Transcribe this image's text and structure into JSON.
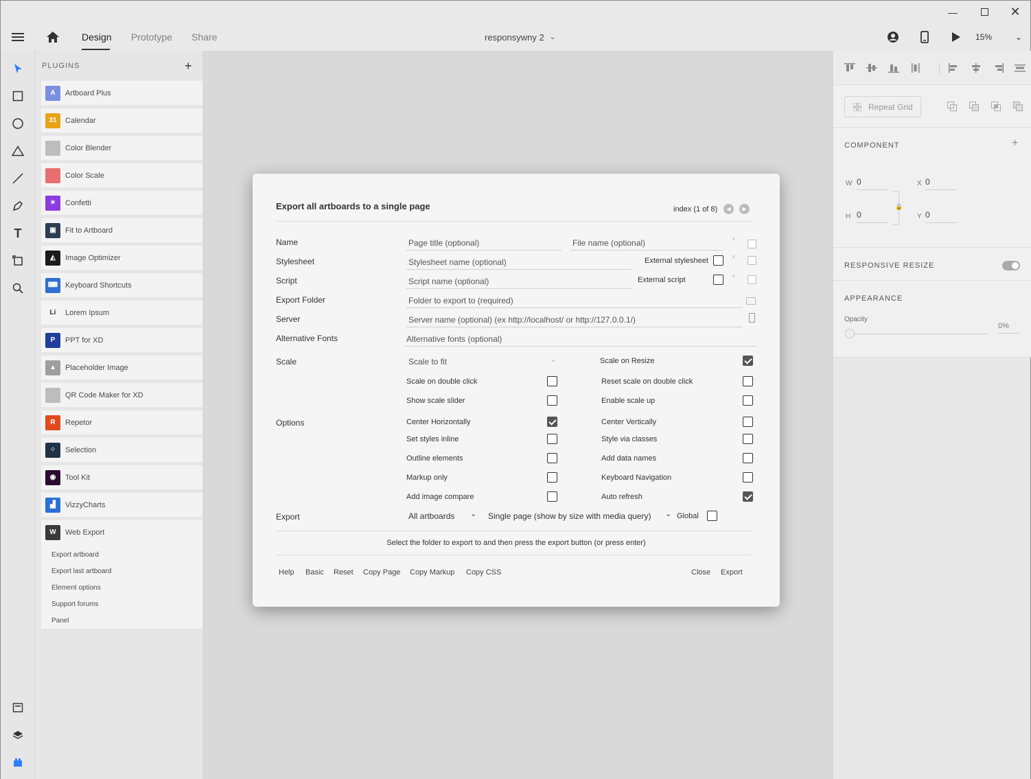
{
  "toolbar": {
    "tab_design": "Design",
    "tab_prototype": "Prototype",
    "tab_share": "Share",
    "doc_title": "responsywny 2",
    "zoom": "15%"
  },
  "plugins": {
    "heading": "PLUGINS",
    "items": [
      {
        "label": "Artboard Plus",
        "icon": "A",
        "color": "#7b8fe0"
      },
      {
        "label": "Calendar",
        "icon": "31",
        "color": "#e8a317"
      },
      {
        "label": "Color Blender",
        "icon": "",
        "color": "#bdbdbd"
      },
      {
        "label": "Color Scale",
        "icon": "",
        "color": "#e96f6f"
      },
      {
        "label": "Confetti",
        "icon": "✶",
        "color": "#8a3ce0"
      },
      {
        "label": "Fit to Artboard",
        "icon": "▣",
        "color": "#2c3e50"
      },
      {
        "label": "Image Optimizer",
        "icon": "◭",
        "color": "#1c1c1c"
      },
      {
        "label": "Keyboard Shortcuts",
        "icon": "⌨",
        "color": "#2f6fd1"
      },
      {
        "label": "Lorem Ipsum",
        "icon": "Li",
        "color": "#f4f4f4"
      },
      {
        "label": "PPT for XD",
        "icon": "P",
        "color": "#1f3f9a"
      },
      {
        "label": "Placeholder Image",
        "icon": "▲",
        "color": "#9e9e9e"
      },
      {
        "label": "QR Code Maker for XD",
        "icon": "",
        "color": "#bdbdbd"
      },
      {
        "label": "Repetor",
        "icon": "R",
        "color": "#e24a1e"
      },
      {
        "label": "Selection",
        "icon": "⁘",
        "color": "#1f3347"
      },
      {
        "label": "Tool Kit",
        "icon": "◉",
        "color": "#2a0a2e"
      },
      {
        "label": "VizzyCharts",
        "icon": "▟",
        "color": "#2a6fd6"
      },
      {
        "label": "Web Export",
        "icon": "W",
        "color": "#3a3a3a"
      }
    ],
    "sub_items": [
      "Export artboard",
      "Export last artboard",
      "Element options",
      "Support forums",
      "Panel"
    ]
  },
  "right": {
    "repeat_grid": "Repeat Grid",
    "component": "COMPONENT",
    "w_label": "W",
    "w_val": "0",
    "x_label": "X",
    "x_val": "0",
    "h_label": "H",
    "h_val": "0",
    "y_label": "Y",
    "y_val": "0",
    "responsive": "RESPONSIVE RESIZE",
    "appearance": "APPEARANCE",
    "opacity": "Opacity",
    "opacity_val": "0%"
  },
  "dialog": {
    "title": "Export all artboards to a single page",
    "index": "index (1 of 8)",
    "name_lbl": "Name",
    "name_ph": "Page title (optional)",
    "file_ph": "File name (optional)",
    "style_lbl": "Stylesheet",
    "style_ph": "Stylesheet name (optional)",
    "ext_style": "External stylesheet",
    "script_lbl": "Script",
    "script_ph": "Script name (optional)",
    "ext_script": "External script",
    "folder_lbl": "Export Folder",
    "folder_ph": "Folder to export to (required)",
    "server_lbl": "Server",
    "server_ph": "Server name (optional) (ex http://localhost/ or http://127.0.0.1/)",
    "alt_lbl": "Alternative Fonts",
    "alt_ph": "Alternative fonts (optional)",
    "scale_lbl": "Scale",
    "scale_val": "Scale to fit",
    "scale_resize": "Scale on Resize",
    "scale_dbl": "Scale on double click",
    "reset_dbl": "Reset scale on double click",
    "scale_slider": "Show scale slider",
    "enable_up": "Enable scale up",
    "options_lbl": "Options",
    "center_h": "Center Horizontally",
    "center_v": "Center Vertically",
    "styles_inline": "Set styles inline",
    "style_classes": "Style via classes",
    "outline": "Outline elements",
    "data_names": "Add data names",
    "markup_only": "Markup only",
    "kbd_nav": "Keyboard Navigation",
    "img_compare": "Add image compare",
    "auto_refresh": "Auto refresh",
    "export_lbl": "Export",
    "export_sel": "All artboards",
    "page_sel": "Single page (show by size with media query)",
    "global": "Global",
    "status": "Select the folder to export to and then press the export button (or press enter)",
    "btn_help": "Help",
    "btn_basic": "Basic",
    "btn_reset": "Reset",
    "btn_copy_page": "Copy Page",
    "btn_copy_markup": "Copy Markup",
    "btn_copy_css": "Copy CSS",
    "btn_close": "Close",
    "btn_export": "Export"
  }
}
